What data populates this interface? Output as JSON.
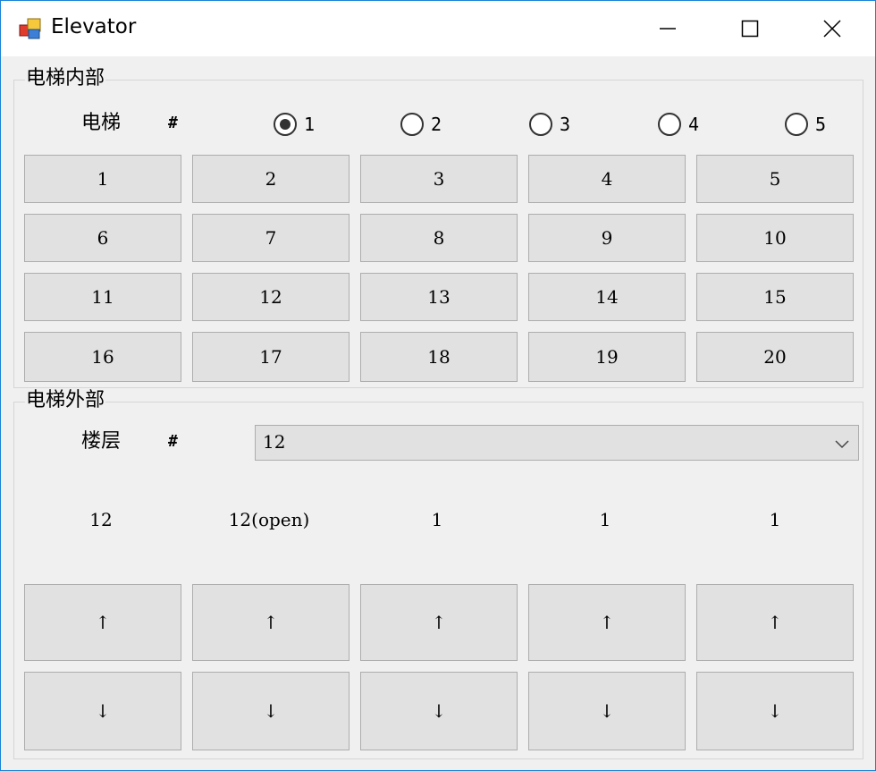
{
  "window": {
    "title": "Elevator"
  },
  "inside": {
    "group_label": "电梯内部",
    "elevator_label": "电梯",
    "hash": "#",
    "radios": [
      {
        "label": "1",
        "checked": true
      },
      {
        "label": "2",
        "checked": false
      },
      {
        "label": "3",
        "checked": false
      },
      {
        "label": "4",
        "checked": false
      },
      {
        "label": "5",
        "checked": false
      }
    ],
    "floor_buttons": [
      "1",
      "2",
      "3",
      "4",
      "5",
      "6",
      "7",
      "8",
      "9",
      "10",
      "11",
      "12",
      "13",
      "14",
      "15",
      "16",
      "17",
      "18",
      "19",
      "20"
    ]
  },
  "outside": {
    "group_label": "电梯外部",
    "floor_label": "楼层",
    "hash": "#",
    "floor_select": {
      "value": "12"
    },
    "elevator_status": [
      "12",
      "12(open)",
      "1",
      "1",
      "1"
    ],
    "up_symbol": "↑",
    "down_symbol": "↓"
  }
}
